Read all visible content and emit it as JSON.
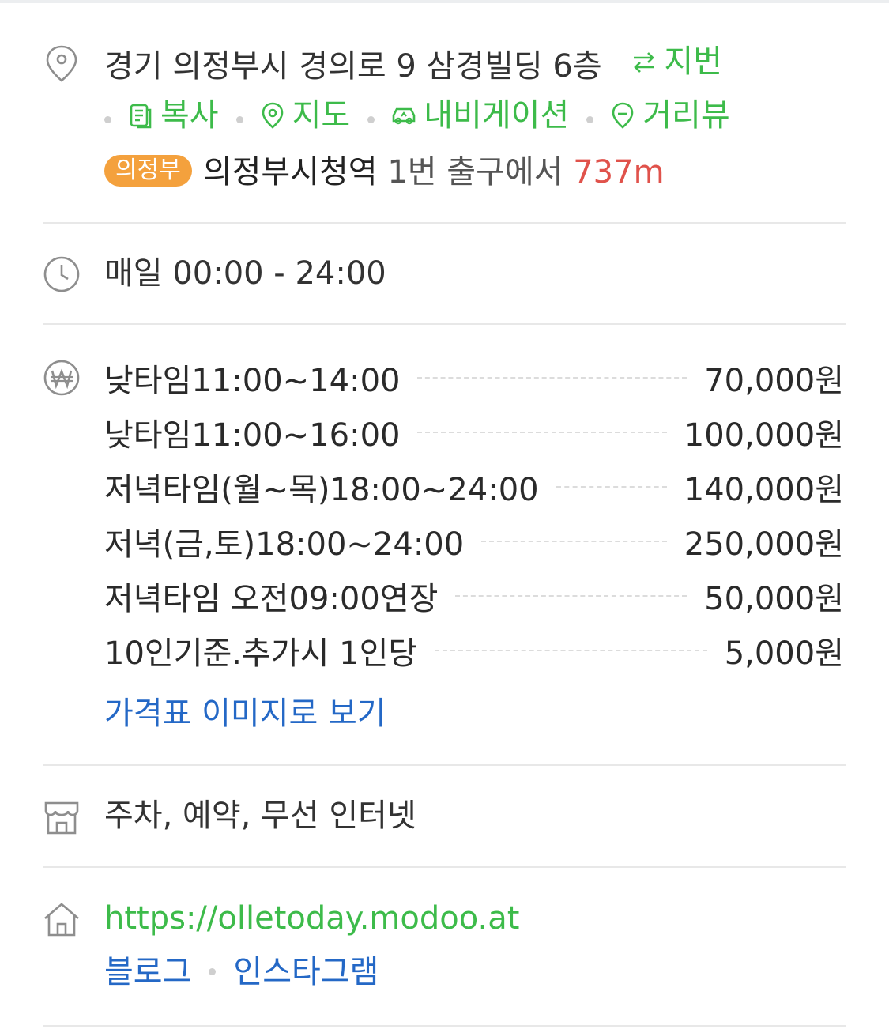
{
  "address": {
    "text": "경기 의정부시 경의로 9 삼경빌딩 6층",
    "jibun_label": "지번",
    "actions": {
      "copy": "복사",
      "map": "지도",
      "navigation": "내비게이션",
      "streetview": "거리뷰"
    },
    "subway": {
      "line_badge": "의정부",
      "station": "의정부시청역",
      "exit": "1번 출구에서",
      "distance": "737m"
    }
  },
  "hours": {
    "text": "매일 00:00 - 24:00"
  },
  "prices": {
    "items": [
      {
        "name": "낮타임11:00~14:00",
        "price": "70,000원"
      },
      {
        "name": "낮타임11:00~16:00",
        "price": "100,000원"
      },
      {
        "name": "저녁타임(월~목)18:00~24:00",
        "price": "140,000원"
      },
      {
        "name": "저녁(금,토)18:00~24:00",
        "price": "250,000원"
      },
      {
        "name": "저녁타임 오전09:00연장",
        "price": "50,000원"
      },
      {
        "name": "10인기준.추가시 1인당",
        "price": "5,000원"
      }
    ],
    "view_image_link": "가격표 이미지로 보기"
  },
  "amenities": {
    "text": "주차, 예약, 무선 인터넷"
  },
  "website": {
    "url": "https://olletoday.modoo.at",
    "links": [
      "블로그",
      "인스타그램"
    ]
  },
  "colors": {
    "green": "#3dbb4a",
    "blue": "#2468c6",
    "distance_red": "#e0524b",
    "badge_orange": "#f4a13d"
  }
}
